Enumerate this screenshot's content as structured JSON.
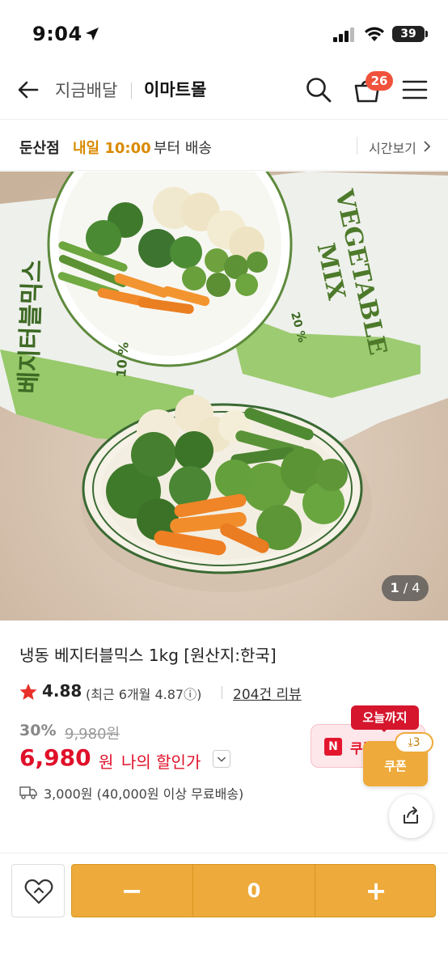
{
  "status_bar": {
    "time": "9:04",
    "battery": "39"
  },
  "header": {
    "title_left": "지금배달",
    "title_main": "이마트몰",
    "cart_count": "26"
  },
  "delivery": {
    "store": "둔산점",
    "time": "내일 10:00",
    "suffix": "부터 배송",
    "time_link": "시간보기"
  },
  "image": {
    "counter_current": "1",
    "counter_total": "/ 4",
    "pack_title_line1": "VEGETABLE",
    "pack_title_line2": "MIX",
    "pack_korean": "베지터블믹스",
    "pack_pct_1": "20 %",
    "pack_pct_2": "10 %"
  },
  "product": {
    "title": "냉동 베지터블믹스 1kg [원산지:한국]",
    "rating": "4.88",
    "rating_recent": "(최근 6개월 4.87ⓘ)",
    "review_count": "204건 리뷰",
    "discount": "30%",
    "original_price": "9,980원",
    "sale_price": "6,980",
    "sale_unit": "원",
    "my_price_label": "나의 할인가",
    "shipping": "3,000원 (40,000원 이상 무료배송)"
  },
  "coupon": {
    "today_tag": "오늘까지",
    "partial_text": "쿠폰",
    "button_label": "쿠폰",
    "download_count": "3",
    "n_logo": "N"
  },
  "bottom": {
    "minus": "−",
    "quantity": "0",
    "plus": "+"
  },
  "colors": {
    "accent": "#eeaa3a",
    "sale_red": "#e0102a",
    "delivery_orange": "#d98a00"
  }
}
